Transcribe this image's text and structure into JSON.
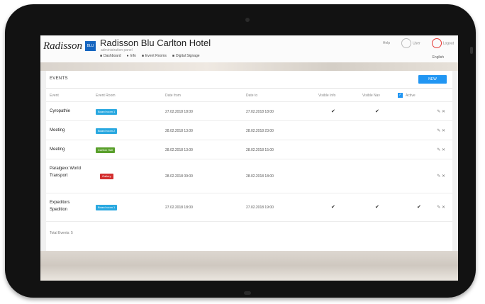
{
  "hotel": {
    "logo_text": "Radisson",
    "logo_badge": "BLU",
    "name": "Radisson Blu Carlton Hotel",
    "subtitle": "administration panel"
  },
  "nav": [
    {
      "icon": "■",
      "label": "Dashboard"
    },
    {
      "icon": "●",
      "label": "Info"
    },
    {
      "icon": "■",
      "label": "Event Rooms"
    },
    {
      "icon": "■",
      "label": "Digital Signage"
    }
  ],
  "header_right": {
    "help": "Help",
    "user": "User",
    "logout": "Logout",
    "language": "English"
  },
  "events": {
    "title": "EVENTS",
    "new_button": "NEW",
    "columns": [
      "Event",
      "Event Room",
      "Date from",
      "Date to",
      "Visible Info",
      "Visible Nav",
      "Active"
    ],
    "rows": [
      {
        "event": "Cyropathie",
        "room": "Board room 1",
        "room_color": "#29a8e0",
        "from": "27.02.2018 18:00",
        "to": "27.02.2018 18:00",
        "info": "✔",
        "navv": "✔",
        "active": ""
      },
      {
        "event": "Meeting",
        "room": "Board room 2",
        "room_color": "#29a8e0",
        "from": "28.02.2018 13:00",
        "to": "28.02.2018 23:00",
        "info": "",
        "navv": "",
        "active": ""
      },
      {
        "event": "Meeting",
        "room": "Carlton Hall",
        "room_color": "#5aa02c",
        "from": "28.02.2018 13:00",
        "to": "28.02.2018 15:00",
        "info": "",
        "navv": "",
        "active": ""
      },
      {
        "event": "Paralgexx World Transport",
        "room": "Gallery",
        "room_color": "#d32f2f",
        "from": "28.02.2018 09:00",
        "to": "28.02.2018 18:00",
        "info": "",
        "navv": "",
        "active": ""
      },
      {
        "event": "Expeditors Spedition",
        "room": "Board room 1",
        "room_color": "#29a8e0",
        "from": "27.02.2018 18:00",
        "to": "27.02.2018 19:00",
        "info": "✔",
        "navv": "✔",
        "active": "✔"
      }
    ],
    "action_icons": "✎ ✕",
    "total": "Total Events: 5"
  }
}
